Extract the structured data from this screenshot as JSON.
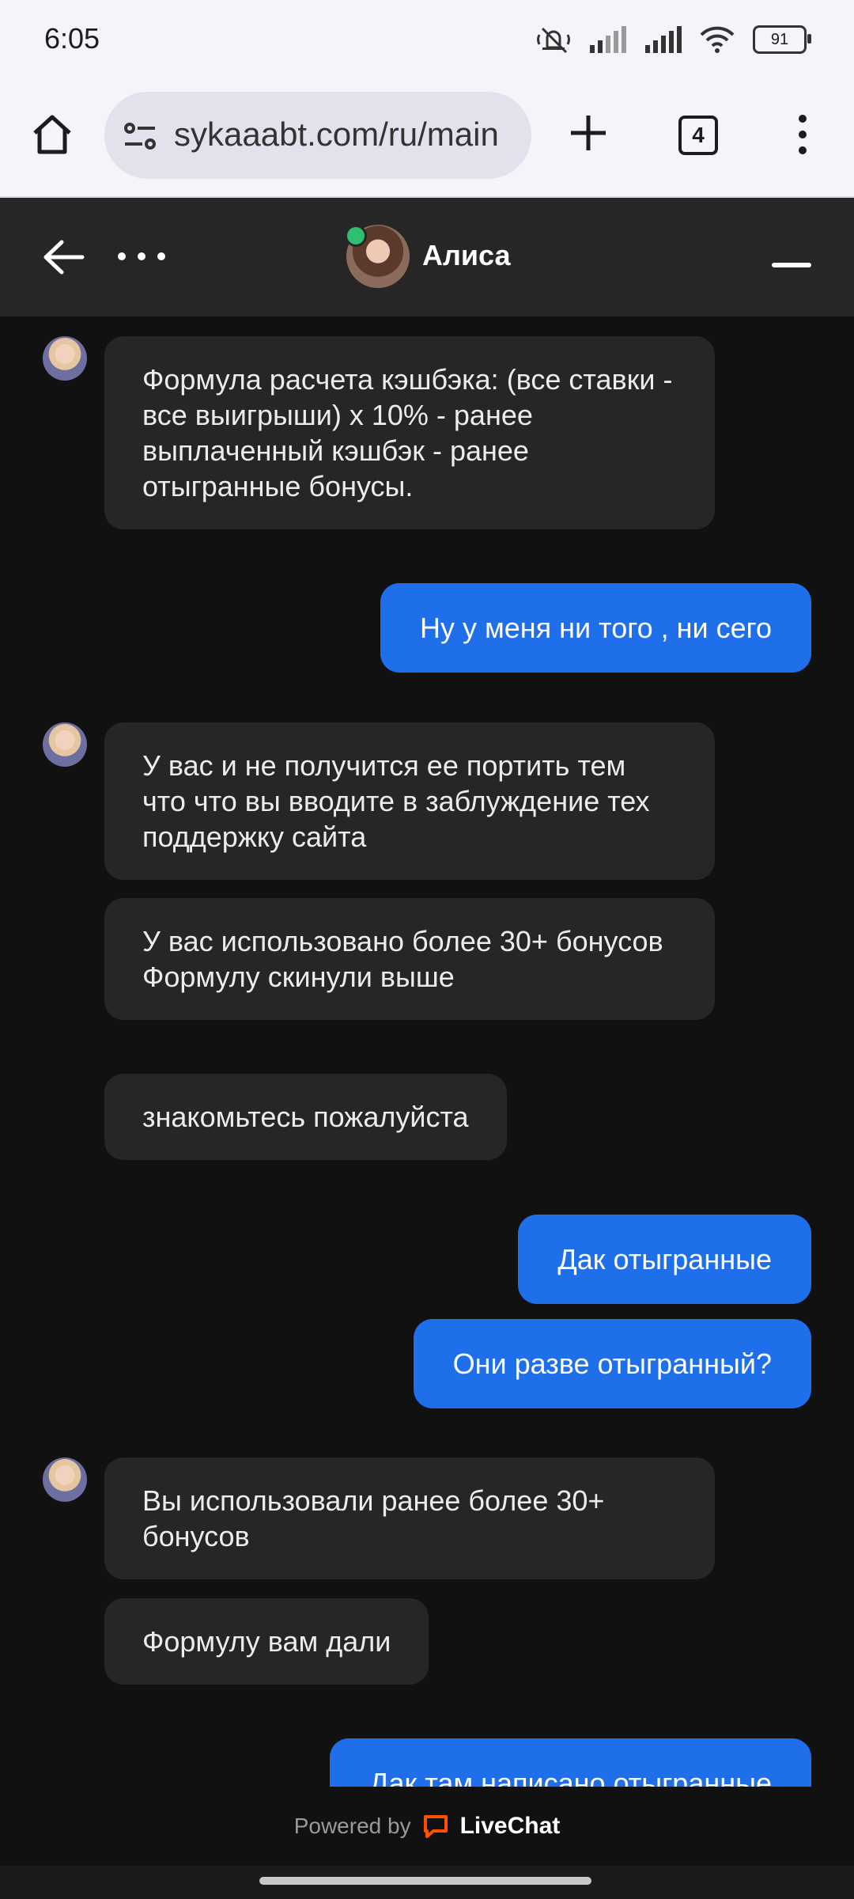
{
  "status_bar": {
    "time": "6:05",
    "battery": "91"
  },
  "browser": {
    "url": "sykaaabt.com/ru/main",
    "tab_count": "4"
  },
  "chat_header": {
    "agent_name": "Алиса"
  },
  "messages": [
    {
      "from": "agent",
      "text": "Формула расчета кэшбэка: (все ставки - все выигрыши) х 10% - ранее выплаченный кэшбэк - ранее отыгранные бонусы."
    },
    {
      "from": "user",
      "text": "Ну у меня ни того , ни сего"
    },
    {
      "from": "agent",
      "text": "У вас и не получится ее портить тем что что вы вводите в заблуждение тех поддержку сайта"
    },
    {
      "from": "agent",
      "text": "У вас использовано более 30+ бонусов\nФормулу скинули выше"
    },
    {
      "from": "agent",
      "text": "знакомьтесь пожалуйста"
    },
    {
      "from": "user",
      "text": "Дак отыгранные"
    },
    {
      "from": "user",
      "text": "Они разве отыгранный?"
    },
    {
      "from": "agent",
      "text": "Вы использовали ранее более 30+ бонусов"
    },
    {
      "from": "agent",
      "text": "Формулу вам дали"
    },
    {
      "from": "user",
      "text": "Дак там написано отыгранные"
    }
  ],
  "footer": {
    "powered_by": "Powered by",
    "brand": "LiveChat",
    "brand_color": "#ff5100"
  },
  "colors": {
    "user_bubble": "#1f6feb",
    "agent_bubble": "#262626",
    "online": "#2fbf71"
  }
}
